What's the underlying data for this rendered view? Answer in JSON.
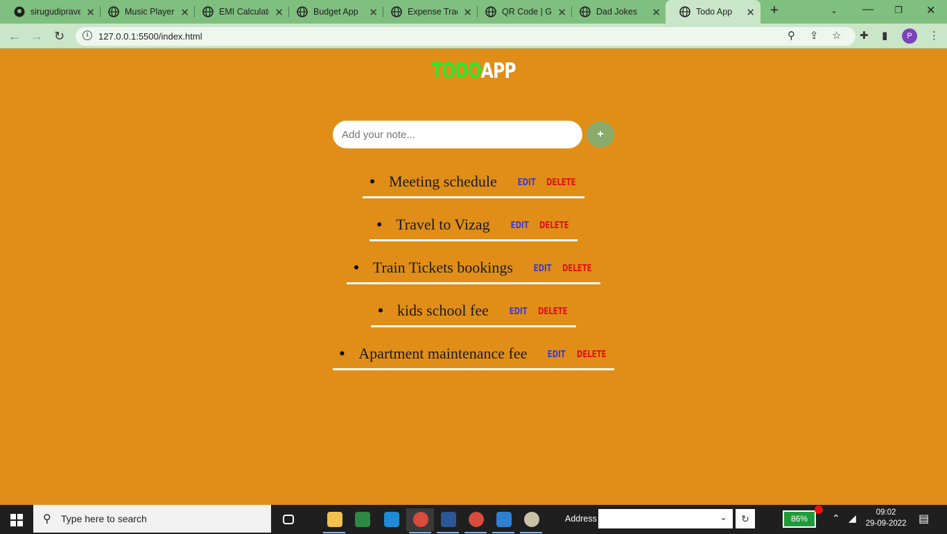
{
  "browser": {
    "tabs": [
      {
        "title": "sirugudipraveen",
        "icon": "github-icon"
      },
      {
        "title": "Music Player",
        "icon": "globe-icon"
      },
      {
        "title": "EMI Calculator",
        "icon": "globe-icon"
      },
      {
        "title": "Budget App",
        "icon": "globe-icon"
      },
      {
        "title": "Expense Tracker",
        "icon": "globe-icon"
      },
      {
        "title": "QR Code | Generator",
        "icon": "globe-icon"
      },
      {
        "title": "Dad Jokes",
        "icon": "globe-icon"
      },
      {
        "title": "Todo App",
        "icon": "globe-icon",
        "active": true
      }
    ],
    "url": "127.0.0.1:5500/index.html",
    "profile_initial": "P"
  },
  "app": {
    "title_part1": "TODO",
    "title_part2": "APP",
    "input_placeholder": "Add your note...",
    "add_button": "+",
    "todos": [
      {
        "text": "Meeting schedule",
        "edit": "EDIT",
        "delete": "DELETE"
      },
      {
        "text": "Travel to Vizag",
        "edit": "EDIT",
        "delete": "DELETE"
      },
      {
        "text": "Train Tickets bookings",
        "edit": "EDIT",
        "delete": "DELETE"
      },
      {
        "text": "kids school fee",
        "edit": "EDIT",
        "delete": "DELETE"
      },
      {
        "text": "Apartment maintenance fee",
        "edit": "EDIT",
        "delete": "DELETE"
      }
    ],
    "colors": {
      "background": "#e08e18",
      "title_green": "#2ee82e",
      "edit": "#3b3bd6",
      "delete": "#e01010",
      "add_button": "#8aab6c"
    }
  },
  "taskbar": {
    "search_placeholder": "Type here to search",
    "address_label": "Address",
    "battery": "86%",
    "time": "09:02",
    "date": "29-09-2022",
    "notifications": "1"
  }
}
